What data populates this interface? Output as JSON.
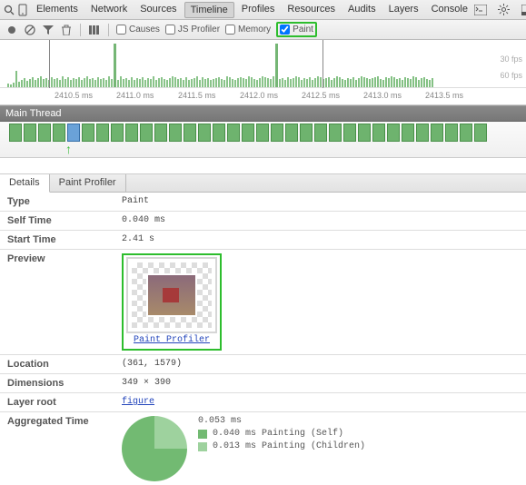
{
  "topbar": {
    "tabs": [
      "Elements",
      "Network",
      "Sources",
      "Timeline",
      "Profiles",
      "Resources",
      "Audits",
      "Layers",
      "Console"
    ],
    "selected": "Timeline"
  },
  "toolbar": {
    "checkboxes": {
      "causes": "Causes",
      "js_profiler": "JS Profiler",
      "memory": "Memory",
      "paint": "Paint"
    }
  },
  "overview": {
    "fps30": "30 fps",
    "fps60": "60 fps",
    "xlabels": [
      "2410.5 ms",
      "2411.0 ms",
      "2411.5 ms",
      "2412.0 ms",
      "2412.5 ms",
      "2413.0 ms",
      "2413.5 ms"
    ]
  },
  "mainthread": {
    "title": "Main Thread"
  },
  "detail_tabs": {
    "details": "Details",
    "paint_profiler": "Paint Profiler"
  },
  "details": {
    "type_k": "Type",
    "type_v": "Paint",
    "self_k": "Self Time",
    "self_v": "0.040 ms",
    "start_k": "Start Time",
    "start_v": "2.41 s",
    "preview_k": "Preview",
    "preview_link": "Paint Profiler",
    "location_k": "Location",
    "location_v": "(361, 1579)",
    "dim_k": "Dimensions",
    "dim_v": "349 × 390",
    "layer_k": "Layer root",
    "layer_v": "figure",
    "agg_k": "Aggregated Time",
    "agg_total": "0.053 ms",
    "agg_self": "0.040 ms Painting (Self)",
    "agg_children": "0.013 ms Painting (Children)"
  },
  "colors": {
    "green_dark": "#72ba72",
    "green_light": "#9ed29e"
  }
}
